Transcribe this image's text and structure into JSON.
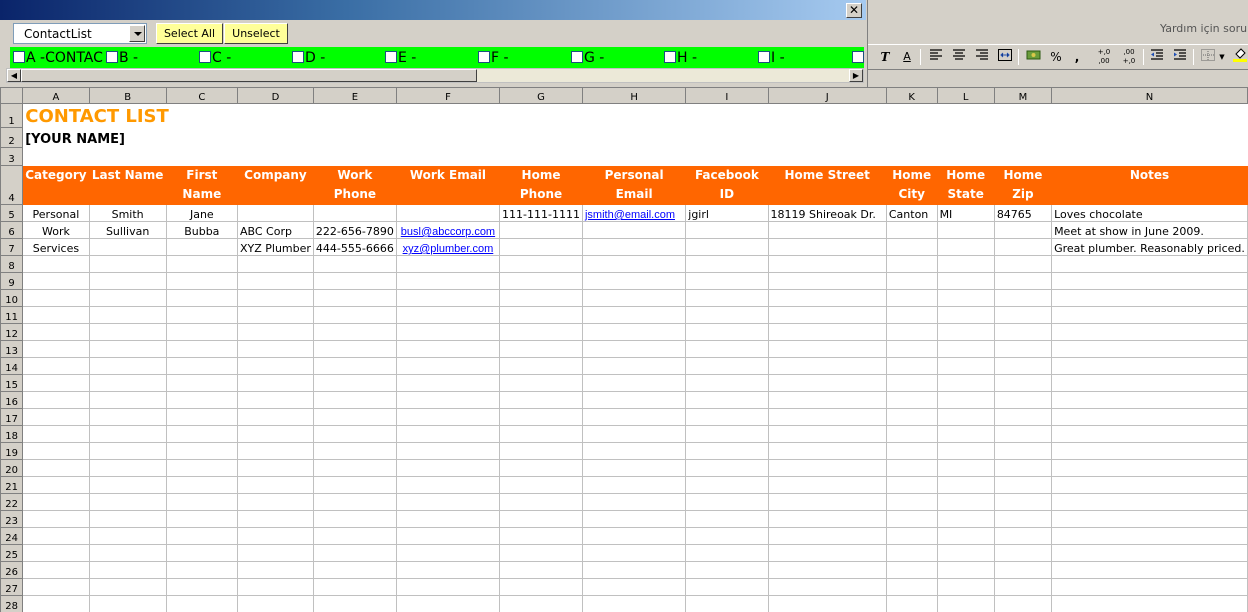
{
  "form": {
    "close_glyph": "✕",
    "sheet_select_value": "ContactList",
    "select_all_label": "Select All",
    "unselect_label": "Unselect",
    "letter_filters": [
      "A -CONTAC",
      "B -",
      "C -",
      "D -",
      "E -",
      "F -",
      "G -",
      "H -",
      "I -",
      ""
    ]
  },
  "excel": {
    "help_placeholder": "Yardım için soru y",
    "toolbar_glyphs": {
      "italic": "T",
      "underline": "A",
      "percent": "%",
      "comma": ",",
      "inc_decimal": "+,0 ,00",
      "dec_decimal": ",00 +,0"
    }
  },
  "sheet": {
    "columns": [
      "A",
      "B",
      "C",
      "D",
      "E",
      "F",
      "G",
      "H",
      "I",
      "J",
      "K",
      "L",
      "M",
      "N"
    ],
    "title": "CONTACT LIST",
    "your_name": "[YOUR NAME]",
    "headers": [
      "Category",
      "Last Name",
      "First Name",
      "Company",
      "Work Phone",
      "Work Email",
      "Home Phone",
      "Personal Email",
      "Facebook ID",
      "Home Street",
      "Home City",
      "Home State",
      "Home Zip",
      "Notes"
    ],
    "rows": [
      [
        "Personal",
        "Smith",
        "Jane",
        "",
        "",
        "",
        "111-111-1111",
        "jsmith@email.com",
        "jgirl",
        "18119 Shireoak Dr.",
        "Canton",
        "MI",
        "84765",
        "Loves chocolate"
      ],
      [
        "Work",
        "Sullivan",
        "Bubba",
        "ABC Corp",
        "222-656-7890",
        "busl@abccorp.com",
        "",
        "",
        "",
        "",
        "",
        "",
        "",
        "Meet at show in June 2009."
      ],
      [
        "Services",
        "",
        "",
        "XYZ Plumber",
        "444-555-6666",
        "xyz@plumber.com",
        "",
        "",
        "",
        "",
        "",
        "",
        "",
        "Great plumber. Reasonably priced."
      ]
    ],
    "row_numbers": [
      "1",
      "2",
      "3",
      "4",
      "5",
      "6",
      "7",
      "8",
      "9",
      "10",
      "11",
      "12",
      "13",
      "14",
      "15",
      "16",
      "17",
      "18",
      "19",
      "20",
      "21",
      "22",
      "23",
      "24",
      "25",
      "26",
      "27",
      "28"
    ]
  }
}
